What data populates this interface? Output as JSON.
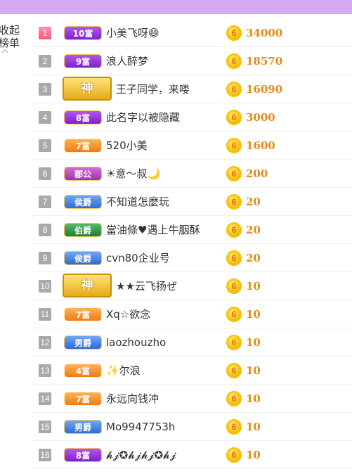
{
  "side": {
    "line1": "收起",
    "line2": "榜单",
    "chevron_icon": "chevron-up-icon"
  },
  "coin_icon": "gold-coin-icon",
  "coin_glyph": "6",
  "colors": {
    "top_bar": "#d3a9f0",
    "amount": "#e58a16",
    "rank_top": "#f45b7c",
    "rank_default": "#a9a9a9"
  },
  "rows": [
    {
      "rank": "1",
      "badge": "10富",
      "badge_color": "purple",
      "name": "小美飞呀😄",
      "amount": "34000"
    },
    {
      "rank": "2",
      "badge": "9富",
      "badge_color": "purple",
      "name": "浪人醉梦",
      "amount": "18570"
    },
    {
      "rank": "3",
      "badge": "神",
      "badge_color": "god",
      "name": "王子同学，来喽",
      "amount": "16090"
    },
    {
      "rank": "4",
      "badge": "8富",
      "badge_color": "purple",
      "name": "此名字以被隐藏",
      "amount": "3000"
    },
    {
      "rank": "5",
      "badge": "7富",
      "badge_color": "orange",
      "name": "520小美",
      "amount": "1600"
    },
    {
      "rank": "6",
      "badge": "郡公",
      "badge_color": "pink",
      "name": "☀意～叔🌙",
      "amount": "200"
    },
    {
      "rank": "7",
      "badge": "侯爵",
      "badge_color": "blue",
      "name": "不知道怎麼玩",
      "amount": "20"
    },
    {
      "rank": "8",
      "badge": "伯爵",
      "badge_color": "green",
      "name": "當油條♥遇上牛胭酥",
      "amount": "20"
    },
    {
      "rank": "9",
      "badge": "侯爵",
      "badge_color": "blue",
      "name": "cvn80企业号",
      "amount": "20"
    },
    {
      "rank": "10",
      "badge": "神",
      "badge_color": "god",
      "name": "★★云飞扬ぜ",
      "amount": "10"
    },
    {
      "rank": "11",
      "badge": "7富",
      "badge_color": "orange",
      "name": "Xq☆欲念",
      "amount": "10"
    },
    {
      "rank": "12",
      "badge": "男爵",
      "badge_color": "blue",
      "name": "laozhouzho",
      "amount": "10"
    },
    {
      "rank": "13",
      "badge": "4富",
      "badge_color": "orange",
      "name": "✨尔浪",
      "amount": "10"
    },
    {
      "rank": "14",
      "badge": "7富",
      "badge_color": "orange",
      "name": "永远向钱冲",
      "amount": "10"
    },
    {
      "rank": "15",
      "badge": "男爵",
      "badge_color": "blue",
      "name": "Mo9947753h",
      "amount": "10"
    },
    {
      "rank": "16",
      "badge": "8富",
      "badge_color": "purple",
      "name": "𝓱𝓳✪𝓱𝓳𝓱𝓳✪𝓱𝓳",
      "amount": "10"
    }
  ]
}
